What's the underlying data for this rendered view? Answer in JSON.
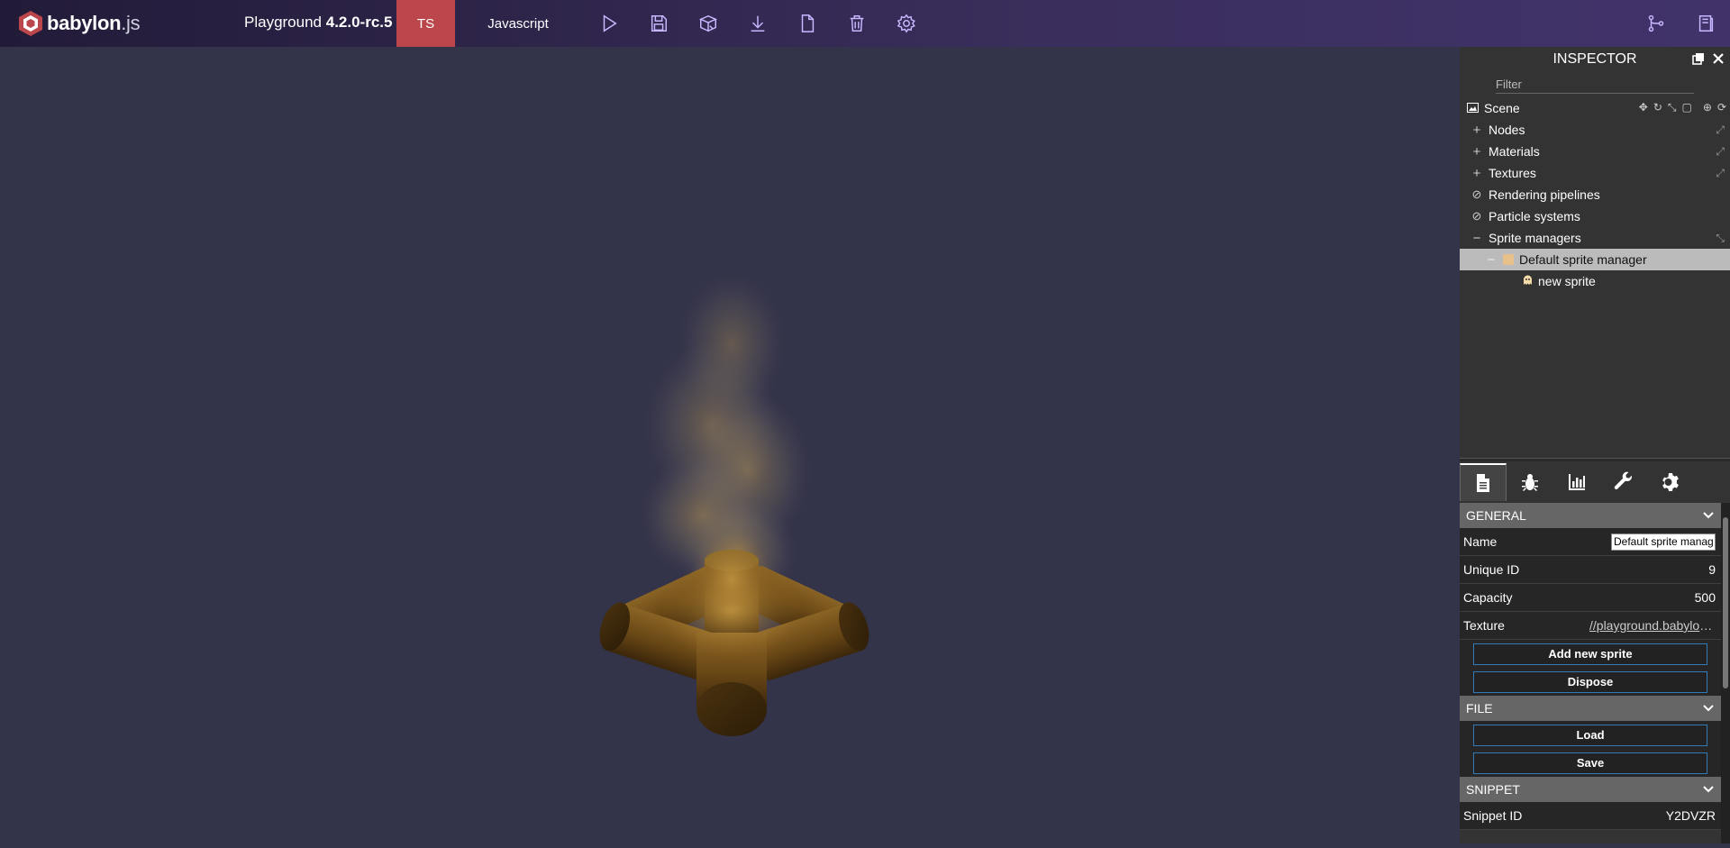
{
  "topbar": {
    "logo_brand": "babylon",
    "logo_suffix": ".js",
    "title_prefix": "Playground ",
    "title_version": "4.2.0-rc.5",
    "tab_ts": "TS",
    "tab_js": "Javascript",
    "icons": [
      "play-icon",
      "save-icon",
      "inspector-icon",
      "download-icon",
      "new-file-icon",
      "clear-icon",
      "settings-icon",
      "version-icon",
      "examples-icon"
    ]
  },
  "inspector": {
    "title": "INSPECTOR",
    "filter_placeholder": "Filter",
    "tree": {
      "scene": "Scene",
      "nodes": "Nodes",
      "materials": "Materials",
      "textures": "Textures",
      "rendering_pipelines": "Rendering pipelines",
      "particle_systems": "Particle systems",
      "sprite_managers": "Sprite managers",
      "default_sprite_manager": "Default sprite manager",
      "new_sprite": "new sprite"
    },
    "tabs": [
      "properties-icon",
      "debug-icon",
      "statistics-icon",
      "tools-icon",
      "settings-icon"
    ],
    "general": {
      "header": "GENERAL",
      "name_label": "Name",
      "name_value": "Default sprite manager",
      "uid_label": "Unique ID",
      "uid_value": "9",
      "capacity_label": "Capacity",
      "capacity_value": "500",
      "texture_label": "Texture",
      "texture_value": "//playground.babylonjs.com/textures/player.png",
      "add_sprite": "Add new sprite",
      "dispose": "Dispose"
    },
    "file": {
      "header": "FILE",
      "load": "Load",
      "save": "Save"
    },
    "snippet": {
      "header": "SNIPPET",
      "id_label": "Snippet ID",
      "id_value": "Y2DVZR"
    }
  }
}
